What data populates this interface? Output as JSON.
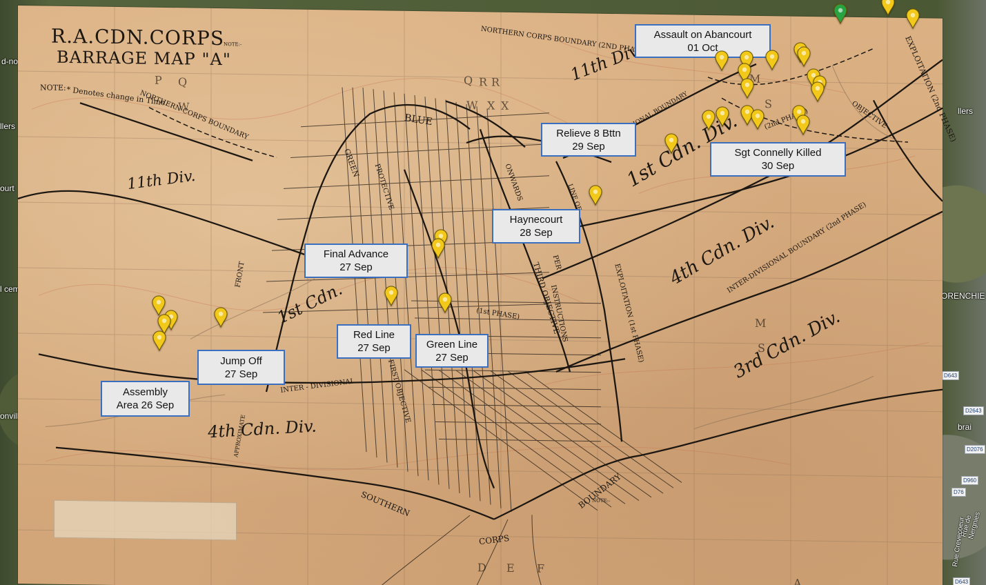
{
  "map": {
    "title_line_1": "R.A.CDN.CORPS",
    "title_line_2": "BARRAGE MAP \"A\"",
    "note_label": "NOTE:",
    "note_text": "* Denotes change in Time.",
    "note_top_left": "NOTE:-",
    "note_top_right": "NOTE:-",
    "sheet_labels": {
      "northern_corps_boundary": "NORTHERN CORPS BOUNDARY",
      "northern_corps_boundary_2nd": "NORTHERN CORPS BOUNDARY (2ND PHASE)",
      "blue_line": "BLUE",
      "green_line": "GREEN",
      "protective": "PROTECTIVE",
      "div_11_left": "11th Div.",
      "div_11_top": "11th Div.",
      "div_1_left": "1st Cdn.",
      "div_1_right": "1st Cdn. Div.",
      "div_4_bottom": "4th Cdn. Div.",
      "div_4_right": "4th Cdn. Div.",
      "div_3_right": "3rd Cdn. Div.",
      "inter_div_boundary_1": "INTER-DIVISIONAL BOUNDARY",
      "inter_div_boundary_2": "INTER-DIVISIONAL BOUNDARY (2nd PHASE)",
      "inter_divisional": "INTER - DIVISIONAL",
      "first_objective": "FIRST OBJECTIVE",
      "third_objective": "THIRD OBJECTIVE",
      "onwards": "ONWARDS",
      "line_of": "LINE OF",
      "exploitation": "EXPLOITATION (1st PHASE)",
      "exploitation_2nd": "EXPLOITATION (2nd PHASE)",
      "instructions": "INSTRUCTIONS",
      "per": "PER",
      "objective": "OBJECTIVE",
      "second_phase": "(2nd PHASE)",
      "first_phase": "(1st PHASE)",
      "southern": "SOUTHERN",
      "boundary": "BOUNDARY",
      "corps": "CORPS",
      "front": "FRONT",
      "approx": "APPROXIMATE",
      "grid_letters": [
        "P",
        "Q",
        "W",
        "R",
        "X",
        "Q",
        "R",
        "W",
        "X",
        "M",
        "S",
        "D",
        "E",
        "F",
        "M",
        "S",
        "A"
      ]
    }
  },
  "satellite": {
    "edge_labels": [
      "d-no",
      "llers",
      "ourt",
      "l cem",
      "onville",
      "llers",
      "ORENCHIE",
      "brai",
      "Rue de Nergnies",
      "Rue Crevecoeur"
    ],
    "roads": [
      "D643",
      "D2643",
      "D2076",
      "D960",
      "D76",
      "D643"
    ]
  },
  "callouts": [
    {
      "id": "assault",
      "line1": "Assault on Abancourt",
      "line2": "01 Oct"
    },
    {
      "id": "relieve",
      "line1": "Relieve 8 Bttn",
      "line2": "29 Sep"
    },
    {
      "id": "connelly",
      "line1": "Sgt Connelly Killed",
      "line2": "30 Sep"
    },
    {
      "id": "haynecourt",
      "line1": "Haynecourt",
      "line2": "28 Sep"
    },
    {
      "id": "final",
      "line1": "Final Advance",
      "line2": "27 Sep"
    },
    {
      "id": "red",
      "line1": "Red Line",
      "line2": "27 Sep"
    },
    {
      "id": "green",
      "line1": "Green Line",
      "line2": "27 Sep"
    },
    {
      "id": "jump",
      "line1": "Jump Off",
      "line2": "27 Sep"
    },
    {
      "id": "assembly",
      "line1": "Assembly",
      "line2": "Area 26 Sep"
    }
  ],
  "colors": {
    "pin_yellow": "#f2c91a",
    "pin_green": "#27a344",
    "callout_border": "#3a6fbf",
    "callout_bg": "#e9e9e9",
    "map_paper": "#d8ad7f",
    "ink": "#1d1712"
  },
  "pins": [
    {
      "color": "green"
    },
    {
      "color": "yellow"
    },
    {
      "color": "yellow"
    },
    {
      "color": "yellow"
    },
    {
      "color": "yellow"
    },
    {
      "color": "yellow"
    },
    {
      "color": "yellow"
    },
    {
      "color": "yellow"
    },
    {
      "color": "yellow"
    },
    {
      "color": "yellow"
    },
    {
      "color": "yellow"
    },
    {
      "color": "yellow"
    },
    {
      "color": "yellow"
    },
    {
      "color": "yellow"
    },
    {
      "color": "yellow"
    },
    {
      "color": "yellow"
    },
    {
      "color": "yellow"
    },
    {
      "color": "yellow"
    },
    {
      "color": "yellow"
    },
    {
      "color": "yellow"
    },
    {
      "color": "yellow"
    },
    {
      "color": "yellow"
    },
    {
      "color": "yellow"
    },
    {
      "color": "yellow"
    },
    {
      "color": "yellow"
    },
    {
      "color": "yellow"
    },
    {
      "color": "yellow"
    },
    {
      "color": "yellow"
    },
    {
      "color": "yellow"
    },
    {
      "color": "yellow"
    }
  ]
}
